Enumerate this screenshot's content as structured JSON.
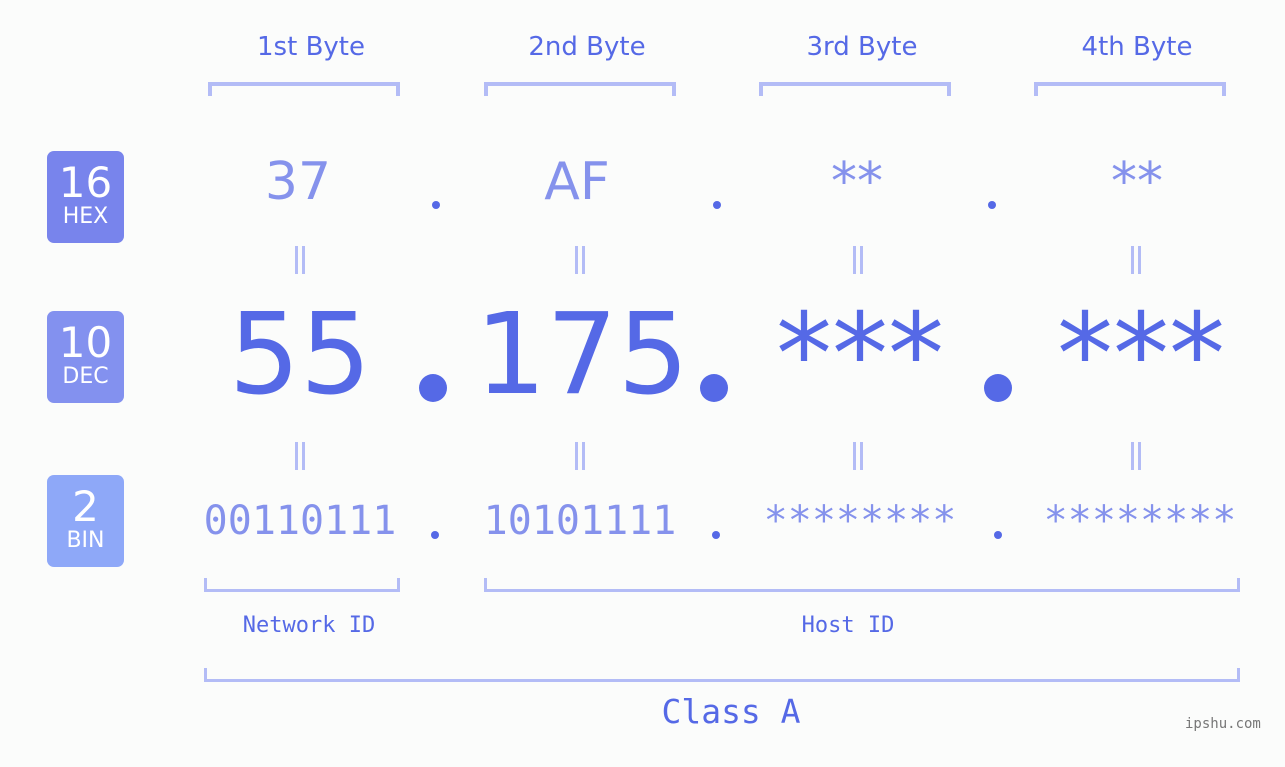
{
  "header": {
    "bytes": [
      "1st Byte",
      "2nd Byte",
      "3rd Byte",
      "4th Byte"
    ]
  },
  "badges": {
    "hex": {
      "num": "16",
      "label": "HEX",
      "color": "#7884ec"
    },
    "dec": {
      "num": "10",
      "label": "DEC",
      "color": "#8391ef"
    },
    "bin": {
      "num": "2",
      "label": "BIN",
      "color": "#8ea8f8"
    }
  },
  "hex": [
    "37",
    "AF",
    "**",
    "**"
  ],
  "dec": [
    "55",
    "175",
    "***",
    "***"
  ],
  "bin": [
    "00110111",
    "10101111",
    "********",
    "********"
  ],
  "labels": {
    "network_id": "Network ID",
    "host_id": "Host ID",
    "class": "Class A"
  },
  "watermark": "ipshu.com",
  "colors": {
    "accent": "#5569e6",
    "light": "#8592ec",
    "bracket": "#b3bcf6",
    "background": "#fbfcfb"
  }
}
